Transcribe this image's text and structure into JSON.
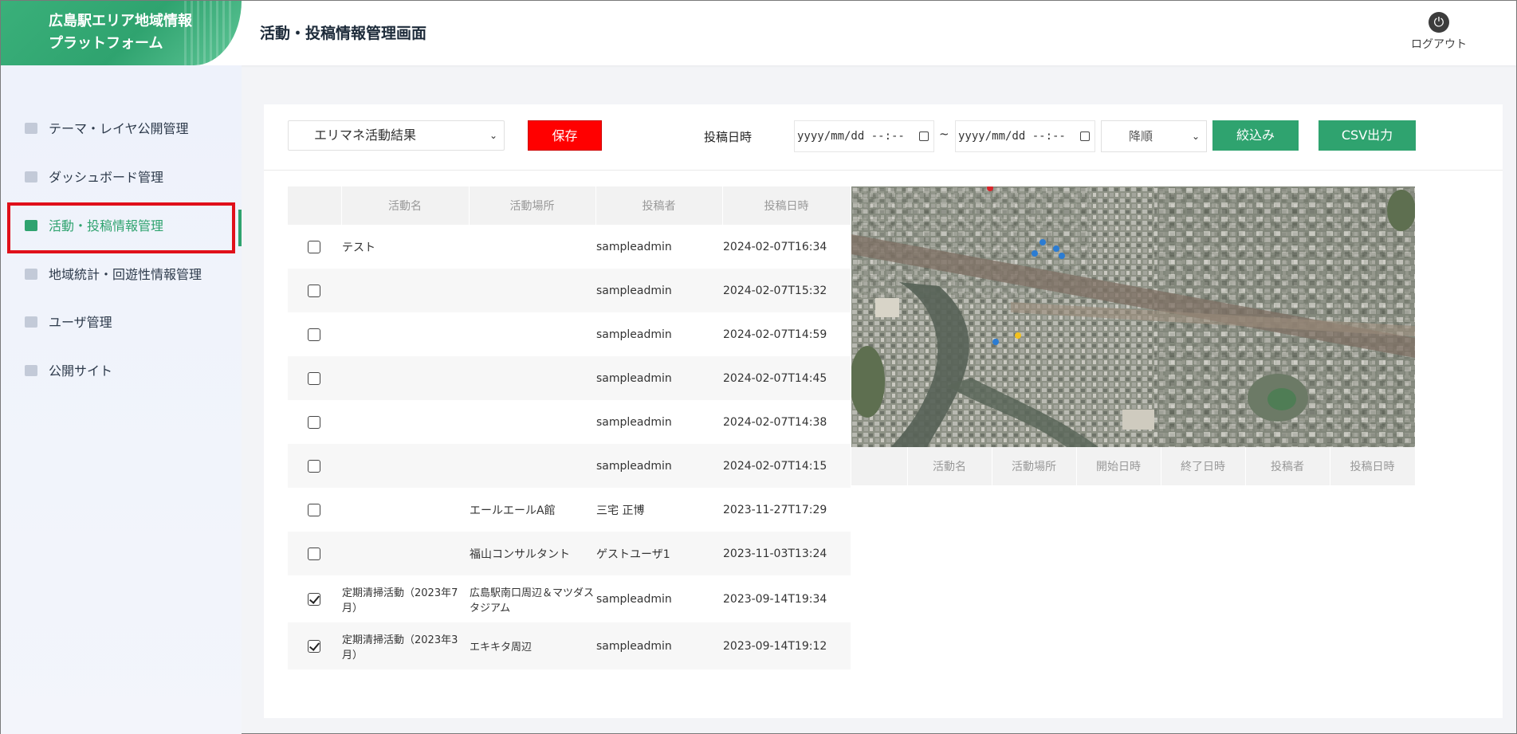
{
  "header": {
    "logo_line1": "広島駅エリア地域情報",
    "logo_line2": "プラットフォーム",
    "title": "活動・投稿情報管理画面",
    "logout_label": "ログアウト"
  },
  "sidebar": {
    "items": [
      {
        "label": "テーマ・レイヤ公開管理",
        "icon": "layer-icon"
      },
      {
        "label": "ダッシュボード管理",
        "icon": "dashboard-icon"
      },
      {
        "label": "活動・投稿情報管理",
        "icon": "box-icon",
        "active": true
      },
      {
        "label": "地域統計・回遊性情報管理",
        "icon": "calendar-icon"
      },
      {
        "label": "ユーザ管理",
        "icon": "user-icon"
      },
      {
        "label": "公開サイト",
        "icon": "monitor-icon"
      }
    ]
  },
  "toolbar": {
    "type_select": "エリマネ活動結果",
    "save_label": "保存",
    "date_label": "投稿日時",
    "date_from_placeholder": "yyyy/mm/dd --:--",
    "date_to_placeholder": "yyyy/mm/dd --:--",
    "tilde": "~",
    "order_select": "降順",
    "filter_label": "絞込み",
    "csv_label": "CSV出力"
  },
  "left_table": {
    "headers": [
      "",
      "活動名",
      "活動場所",
      "投稿者",
      "投稿日時"
    ],
    "rows": [
      {
        "checked": false,
        "name": "テスト",
        "place": "",
        "poster": "sampleadmin",
        "date": "2024-02-07T16:34"
      },
      {
        "checked": false,
        "name": "",
        "place": "",
        "poster": "sampleadmin",
        "date": "2024-02-07T15:32"
      },
      {
        "checked": false,
        "name": "",
        "place": "",
        "poster": "sampleadmin",
        "date": "2024-02-07T14:59"
      },
      {
        "checked": false,
        "name": "",
        "place": "",
        "poster": "sampleadmin",
        "date": "2024-02-07T14:45"
      },
      {
        "checked": false,
        "name": "",
        "place": "",
        "poster": "sampleadmin",
        "date": "2024-02-07T14:38"
      },
      {
        "checked": false,
        "name": "",
        "place": "",
        "poster": "sampleadmin",
        "date": "2024-02-07T14:15"
      },
      {
        "checked": false,
        "name": "",
        "place": "エールエールA館",
        "poster": "三宅 正博",
        "date": "2023-11-27T17:29"
      },
      {
        "checked": false,
        "name": "",
        "place": "福山コンサルタント",
        "poster": "ゲストユーザ1",
        "date": "2023-11-03T13:24"
      },
      {
        "checked": true,
        "name": "定期清掃活動（2023年7月）",
        "place": "広島駅南口周辺＆マツダスタジアム",
        "poster": "sampleadmin",
        "date": "2023-09-14T19:34"
      },
      {
        "checked": true,
        "name": "定期清掃活動（2023年3月）",
        "place": "エキキタ周辺",
        "poster": "sampleadmin",
        "date": "2023-09-14T19:12"
      }
    ]
  },
  "right_table": {
    "headers": [
      "",
      "活動名",
      "活動場所",
      "開始日時",
      "終了日時",
      "投稿者",
      "投稿日時"
    ]
  },
  "colors": {
    "brand_green": "#2fa36f",
    "save_red": "#ff0000",
    "highlight_red": "#e0101a"
  }
}
